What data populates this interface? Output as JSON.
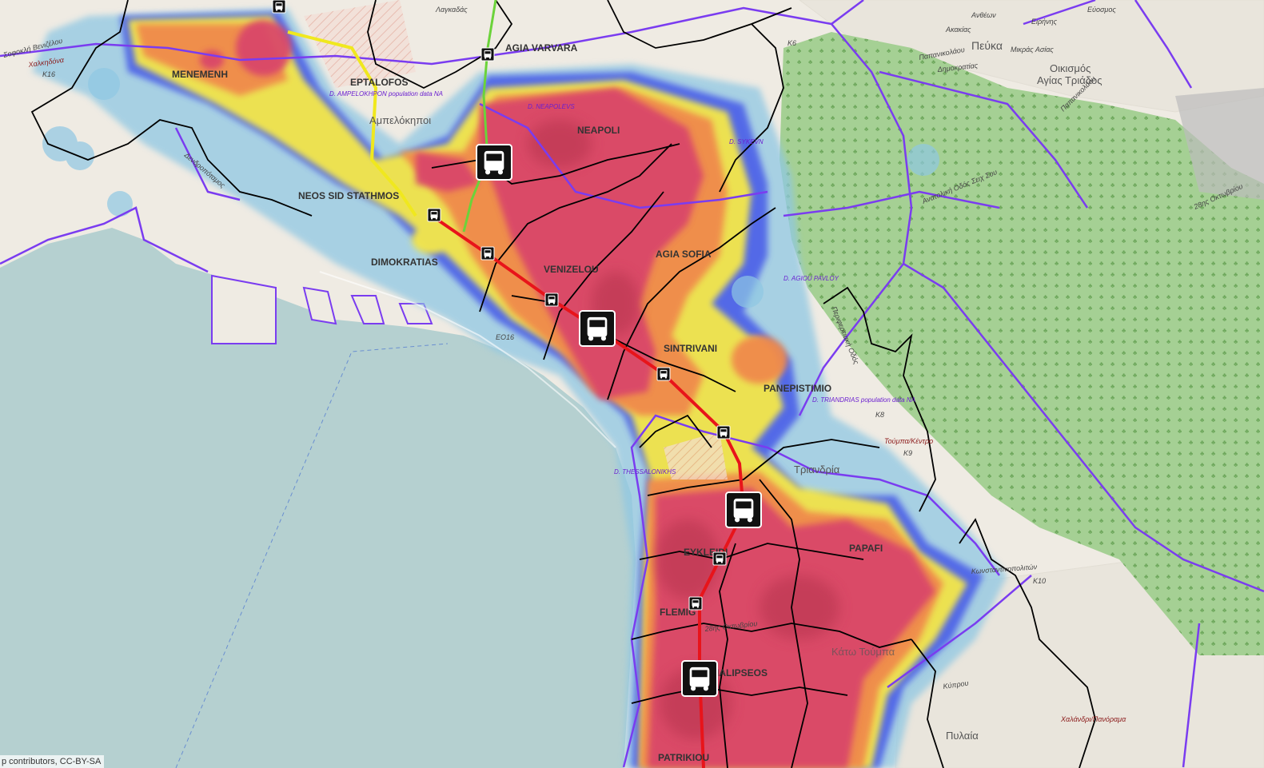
{
  "map": {
    "attribution": "p contributors, CC-BY-SA",
    "colors": {
      "sea": "#b5d0d0",
      "land": "#f0ece4",
      "forest": "#9ccc8a",
      "heat_high": "#d9456a",
      "heat_mid": "#f08a4b",
      "heat_low": "#f5e84a",
      "heat_edge": "#3f4ee0",
      "heat_fringe": "#8fc7e3",
      "metro_line": "#e8141a",
      "tram_green": "#6bd33a",
      "tram_yellow": "#f0e81e",
      "boundary_purple": "#7a3cf0",
      "boundary_black": "#000000"
    },
    "districts": [
      {
        "id": "menemeni",
        "label": "MENEMENH"
      },
      {
        "id": "eptalofos",
        "label": "EPTALOFOS"
      },
      {
        "id": "agia-varvara",
        "label": "AGIA VARVARA"
      },
      {
        "id": "neapoli",
        "label": "NEAPOLI"
      },
      {
        "id": "neos-sid-stathmos",
        "label": "NEOS SID STATHMOS"
      },
      {
        "id": "dimokratias",
        "label": "DIMOKRATIAS"
      },
      {
        "id": "venizelou",
        "label": "VENIZELOU"
      },
      {
        "id": "agia-sofia",
        "label": "AGIA SOFIA"
      },
      {
        "id": "sintrivani",
        "label": "SINTRIVANI"
      },
      {
        "id": "panepistimio",
        "label": "PANEPISTIMIO"
      },
      {
        "id": "eykleidi",
        "label": "EYKLEIDI"
      },
      {
        "id": "papafi",
        "label": "PAPAFI"
      },
      {
        "id": "flemig",
        "label": "FLEMIG"
      },
      {
        "id": "analipseos",
        "label": "ANALIPSEOS"
      },
      {
        "id": "patrikiou",
        "label": "PATRIKIOU"
      }
    ],
    "places": [
      {
        "id": "pefka",
        "label": "Πεύκα"
      },
      {
        "id": "oikismos",
        "label": "Οικισμός"
      },
      {
        "id": "agias-triados",
        "label": "Αγίας Τριάδος"
      },
      {
        "id": "ampelokipoi",
        "label": "Αμπελόκηποι"
      },
      {
        "id": "triandria",
        "label": "Τριανδρία"
      },
      {
        "id": "pylaia",
        "label": "Πυλαία"
      },
      {
        "id": "kato-toumpa",
        "label": "Κάτω Τούμπα"
      }
    ],
    "roads": [
      {
        "id": "sofokli-venizelou",
        "label": "Σοφοκλή Βενιζέλου"
      },
      {
        "id": "mikras-asias",
        "label": "Μικράς Ασίας"
      },
      {
        "id": "papanikolaou",
        "label": "Παπανικολάου"
      },
      {
        "id": "dimokratias-road",
        "label": "Δημοκρατίας"
      },
      {
        "id": "anthewn",
        "label": "Ανθέων"
      },
      {
        "id": "akakias",
        "label": "Ακακίας"
      },
      {
        "id": "eirinis",
        "label": "Ειρήνης"
      },
      {
        "id": "periferiaki",
        "label": "Περιφερειακή Οδός"
      },
      {
        "id": "anatoliki-seix-sou",
        "label": "Ανατολική Οδός Σειχ Σου"
      },
      {
        "id": "28is-oktovriou-east",
        "label": "28ης Οκτωβρίου"
      },
      {
        "id": "papanikolaou-2",
        "label": "Παπανικολάου"
      },
      {
        "id": "konstantinoupoliton",
        "label": "Κωνσταντινοπολιτών"
      },
      {
        "id": "28is-oktovriou-south",
        "label": "28ης Οκτωβρίου"
      },
      {
        "id": "kyprou",
        "label": "Κύπρου"
      },
      {
        "id": "eo16",
        "label": "ΕΟ16"
      },
      {
        "id": "k16",
        "label": "Κ16"
      },
      {
        "id": "k6",
        "label": "Κ6"
      },
      {
        "id": "k8",
        "label": "Κ8"
      },
      {
        "id": "k9",
        "label": "Κ9"
      },
      {
        "id": "k10",
        "label": "Κ10"
      },
      {
        "id": "xalandri-panorama",
        "label": "Χαλάνδρι/Πανόραμα"
      },
      {
        "id": "toumpa-kentro",
        "label": "Τούμπα/Κέντρο"
      },
      {
        "id": "evosmos",
        "label": "Εύοσμος"
      },
      {
        "id": "xalkidona",
        "label": "Χαλκηδόνα"
      },
      {
        "id": "dendropotamos",
        "label": "Δενδροπόταμος"
      },
      {
        "id": "lagadas",
        "label": "Λαγκαδάς"
      }
    ],
    "data_notes": [
      {
        "id": "d-ampelokhpoi",
        "label": "D. AMPELOKHPON population data NA"
      },
      {
        "id": "d-neapolews",
        "label": "D. NEAPOLEVS"
      },
      {
        "id": "d-agiou-pavlou",
        "label": "D. AGIOU PAVLOY"
      },
      {
        "id": "d-triandrias",
        "label": "D. TRIANDRIAS population data NA"
      },
      {
        "id": "d-thessalonikis",
        "label": "D. THESSALONIKHS"
      },
      {
        "id": "d-sykewn",
        "label": "D. SYKEVN"
      }
    ],
    "bus_stops": [
      {
        "id": "bus-major-1",
        "size": "large"
      },
      {
        "id": "bus-major-2",
        "size": "large"
      },
      {
        "id": "bus-major-3",
        "size": "large"
      },
      {
        "id": "bus-major-4",
        "size": "large"
      },
      {
        "id": "bus-minor-1",
        "size": "small"
      },
      {
        "id": "bus-minor-2",
        "size": "small"
      },
      {
        "id": "bus-minor-3",
        "size": "small"
      },
      {
        "id": "bus-minor-4",
        "size": "small"
      },
      {
        "id": "bus-minor-5",
        "size": "small"
      },
      {
        "id": "bus-minor-6",
        "size": "small"
      },
      {
        "id": "bus-minor-7",
        "size": "small"
      },
      {
        "id": "bus-minor-8",
        "size": "small"
      }
    ]
  }
}
